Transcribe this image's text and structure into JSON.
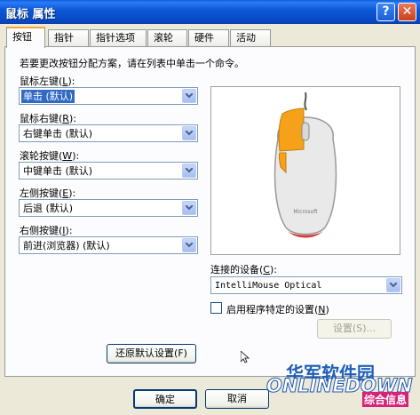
{
  "window": {
    "title": "鼠标 属性",
    "help_glyph": "?",
    "close_glyph": "✕"
  },
  "tabs": [
    "按钮",
    "指针",
    "指针选项",
    "滚轮",
    "硬件",
    "活动"
  ],
  "instruction": "若要更改按钮分配方案，请在列表中单击一个命令。",
  "fields": [
    {
      "label": "鼠标左键",
      "hotkey": "L",
      "value": "单击 (默认)",
      "selected": true
    },
    {
      "label": "鼠标右键",
      "hotkey": "R",
      "value": "右键单击 (默认)"
    },
    {
      "label": "滚轮按键",
      "hotkey": "W",
      "value": "中键单击 (默认)"
    },
    {
      "label": "左侧按键",
      "hotkey": "E",
      "value": "后退 (默认)"
    },
    {
      "label": "右侧按键",
      "hotkey": "I",
      "value": "前进(浏览器) (默认)"
    }
  ],
  "device": {
    "label": "连接的设备",
    "hotkey": "C",
    "value": "IntelliMouse Optical",
    "brand": "Microsoft"
  },
  "app_specific": {
    "label": "启用程序特定的设置",
    "hotkey": "N",
    "checked": false
  },
  "settings_button": "设置(S)...",
  "restore_button": "还原默认设置(F)",
  "ok_button": "确定",
  "cancel_button": "取消",
  "watermark": {
    "cn": "华军软件园",
    "en": "ONLINEDOWN",
    "sub": "综合信息"
  },
  "colors": {
    "title_blue": "#0b59d8",
    "accent_orange": "#f3a63b",
    "mouse_orange": "#f5a21a",
    "select_blue": "#316ac5"
  }
}
